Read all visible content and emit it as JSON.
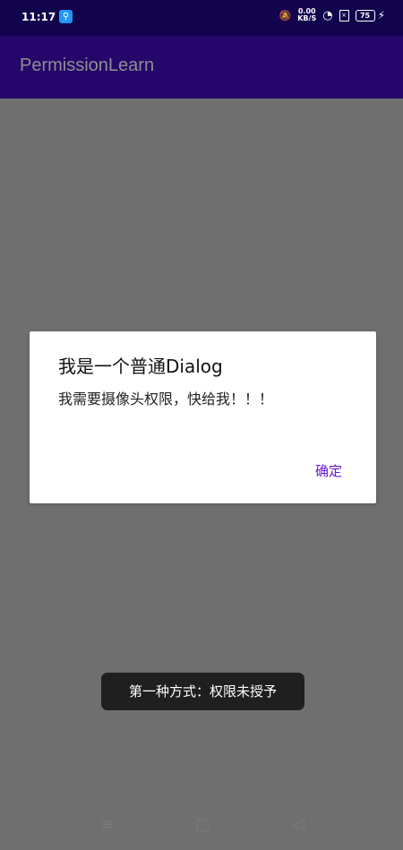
{
  "status_bar": {
    "time": "11:17",
    "speed_value": "0.00",
    "speed_unit": "KB/S",
    "battery": "75"
  },
  "app_bar": {
    "title": "PermissionLearn"
  },
  "dialog": {
    "title": "我是一个普通Dialog",
    "message": "我需要摄像头权限，快给我！！！",
    "confirm_label": "确定"
  },
  "toast": {
    "text": "第一种方式：权限未授予"
  },
  "navigation": {
    "menu_icon": "menu-icon",
    "home_icon": "home-icon",
    "back_icon": "back-icon"
  },
  "colors": {
    "status_bar": "#12034d",
    "app_bar": "#25066a",
    "overlay": "#6f6f6f",
    "accent": "#6a16d8"
  }
}
